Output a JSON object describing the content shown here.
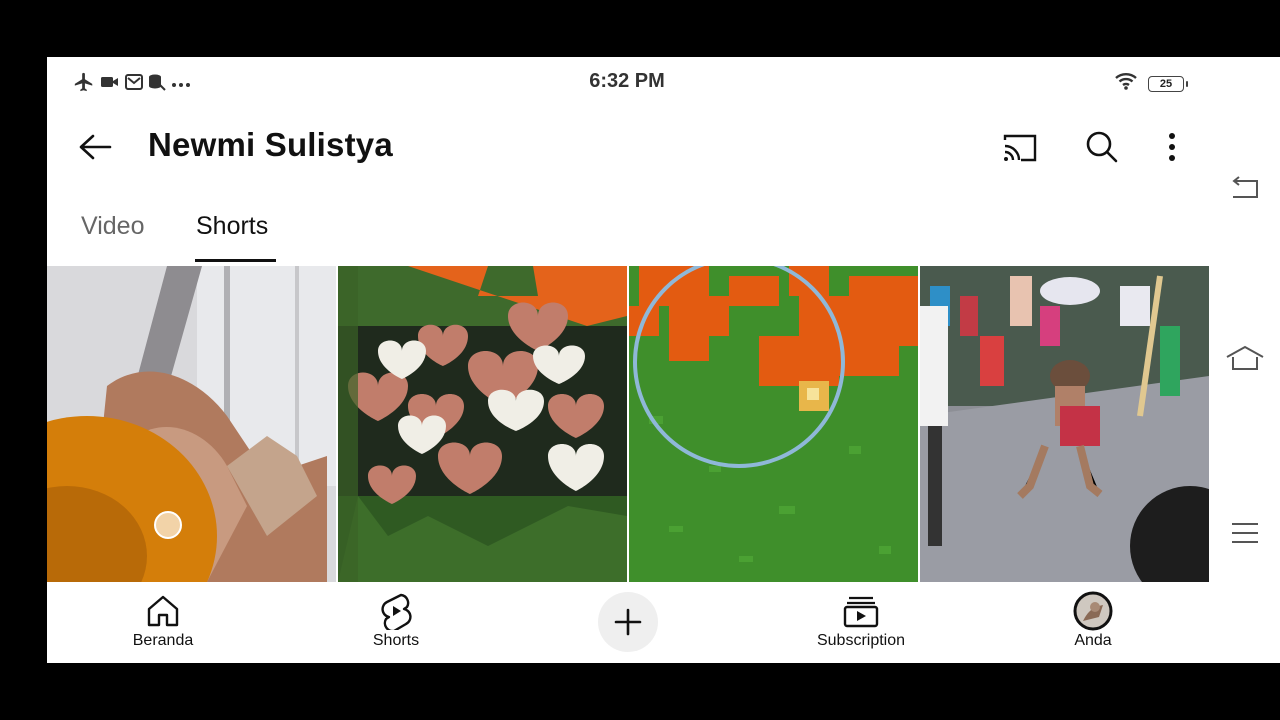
{
  "status_bar": {
    "time": "6:32 PM",
    "battery": "25",
    "left_icons": [
      "airplane-icon",
      "video-icon",
      "mail-icon",
      "data-icon",
      "more-dots-icon"
    ],
    "right_icons": [
      "wifi-icon",
      "battery-icon"
    ]
  },
  "header": {
    "title": "Newmi Sulistya",
    "icons": [
      "back-arrow-icon",
      "cast-icon",
      "search-icon",
      "more-vertical-icon"
    ]
  },
  "tabs": [
    {
      "label": "Video",
      "selected": false
    },
    {
      "label": "Shorts",
      "selected": true
    }
  ],
  "bottom_nav": {
    "items": [
      {
        "label": "Beranda",
        "icon": "home-icon"
      },
      {
        "label": "Shorts",
        "icon": "shorts-icon"
      },
      {
        "label": "",
        "icon": "plus-icon"
      },
      {
        "label": "Subscription",
        "icon": "subscriptions-icon"
      },
      {
        "label": "Anda",
        "icon": "avatar"
      }
    ]
  },
  "colors": {
    "accent": "#111111",
    "tab_inactive": "#666666",
    "screen_bg": "#ffffff",
    "frame_bg": "#000000"
  }
}
